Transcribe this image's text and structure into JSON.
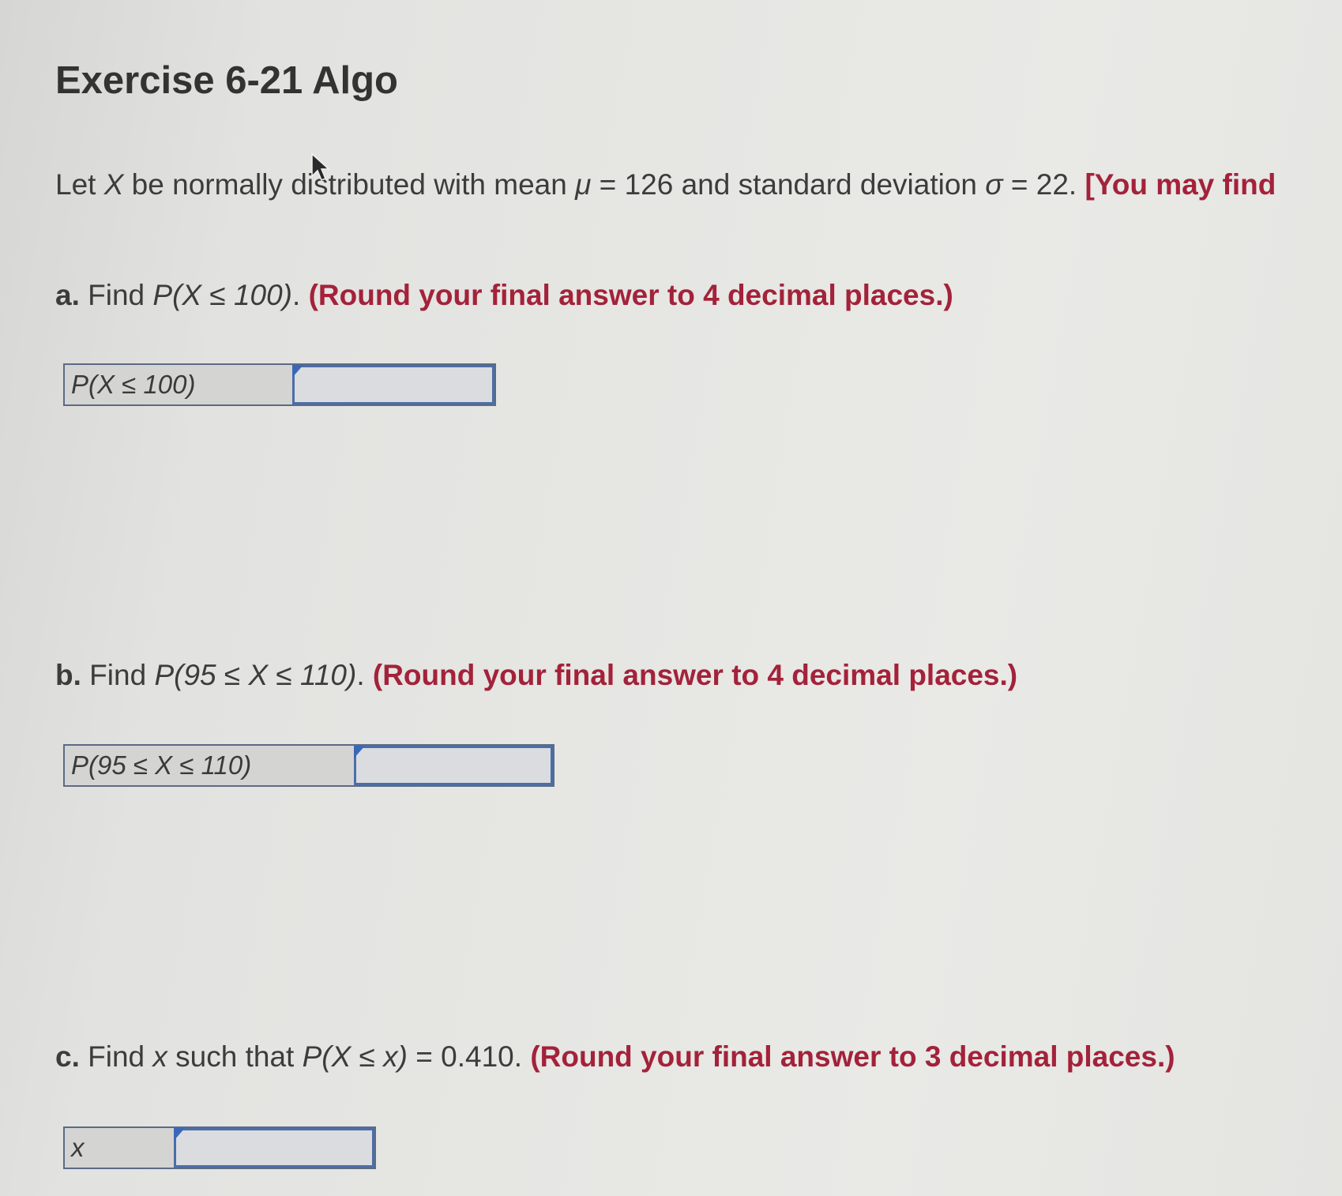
{
  "title": "Exercise 6-21 Algo",
  "intro": {
    "text1": "Let ",
    "var": "X",
    "text2": " be normally distributed with mean ",
    "mu": "μ",
    "text3": " = 126 and standard deviation ",
    "sigma": "σ",
    "text4": " = 22. ",
    "note": "[You may find"
  },
  "questions": [
    {
      "letter": "a.",
      "prefix": " Find ",
      "expr": "P(X ≤ 100)",
      "suffix": ". ",
      "instruction": "(Round your final answer to 4 decimal places.)",
      "answer_label": "P(X ≤ 100)",
      "answer_value": ""
    },
    {
      "letter": "b.",
      "prefix": " Find ",
      "expr": "P(95 ≤ X ≤ 110)",
      "suffix": ". ",
      "instruction": "(Round your final answer to 4 decimal places.)",
      "answer_label": "P(95 ≤ X ≤ 110)",
      "answer_value": ""
    },
    {
      "letter": "c.",
      "prefix": " Find ",
      "var": "x",
      "mid": " such that ",
      "expr": "P(X ≤ x)",
      "suffix": " = 0.410. ",
      "instruction": "(Round your final answer to 3 decimal places.)",
      "answer_label": "x",
      "answer_value": ""
    }
  ],
  "colors": {
    "instruction": "#a3223a",
    "input_border": "#4b6ea8",
    "flag": "#3a68b8"
  },
  "icons": {
    "cursor": "mouse-pointer-icon",
    "flag": "input-corner-flag-icon"
  }
}
